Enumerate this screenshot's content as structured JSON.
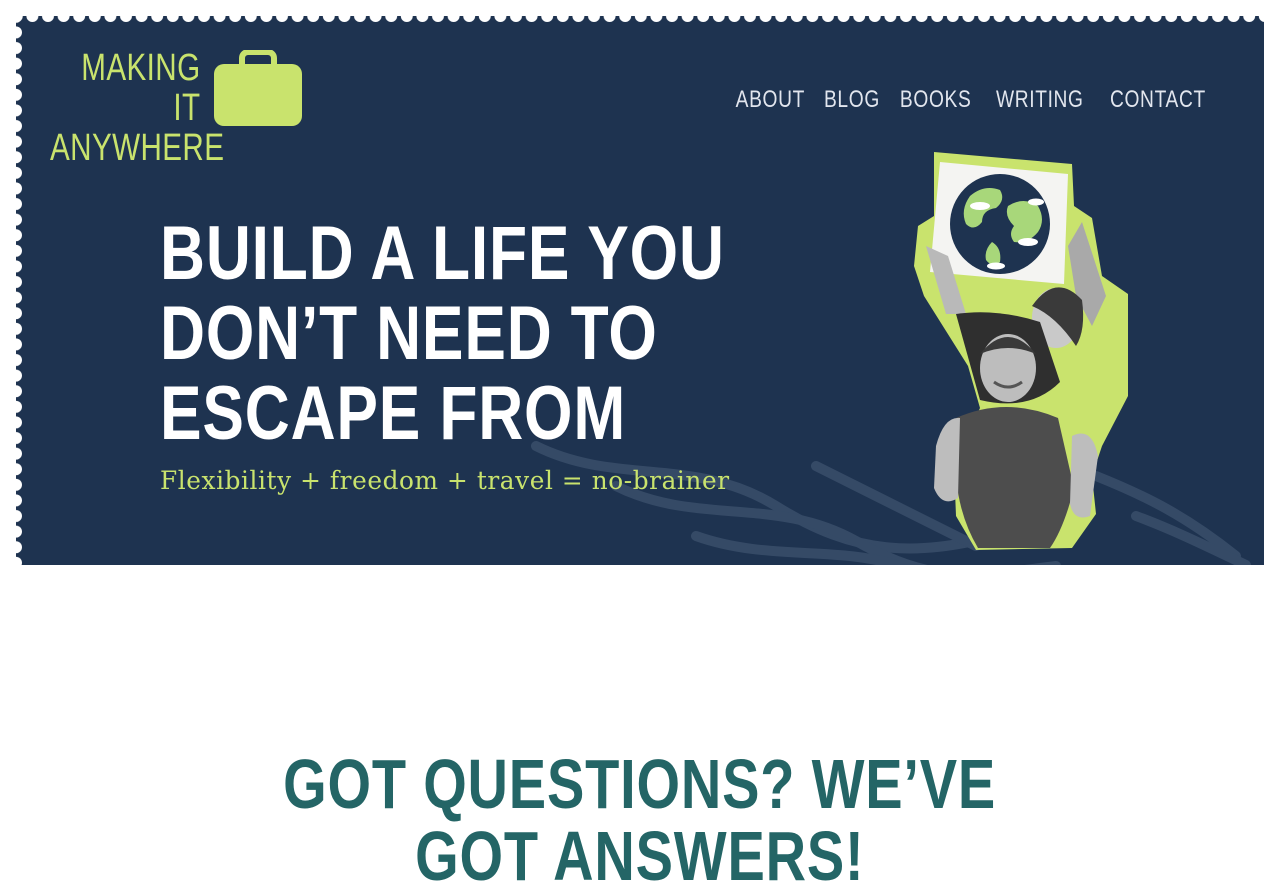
{
  "site": {
    "logo_line1": "MAKING IT",
    "logo_line2": "ANYWHERE",
    "logo_icon": "suitcase-icon"
  },
  "nav": {
    "items": [
      {
        "label": "ABOUT"
      },
      {
        "label": "BLOG"
      },
      {
        "label": "BOOKS"
      },
      {
        "label": "WRITING"
      },
      {
        "label": "CONTACT"
      }
    ]
  },
  "hero": {
    "headline_lines": [
      "BUILD A LIFE YOU",
      "DON’T NEED TO",
      "ESCAPE FROM"
    ],
    "tagline": "Flexibility + freedom + travel = no-brainer",
    "photo": "couple-holding-globe-sign-photo"
  },
  "faq": {
    "heading_line1": "GOT QUESTIONS? WE’VE",
    "heading_line2": "GOT ANSWERS!"
  },
  "colors": {
    "hero_bg": "#1e3350",
    "accent_lime": "#c9e36d",
    "heading_teal": "#246566",
    "nav_text": "#e2e6ee"
  }
}
